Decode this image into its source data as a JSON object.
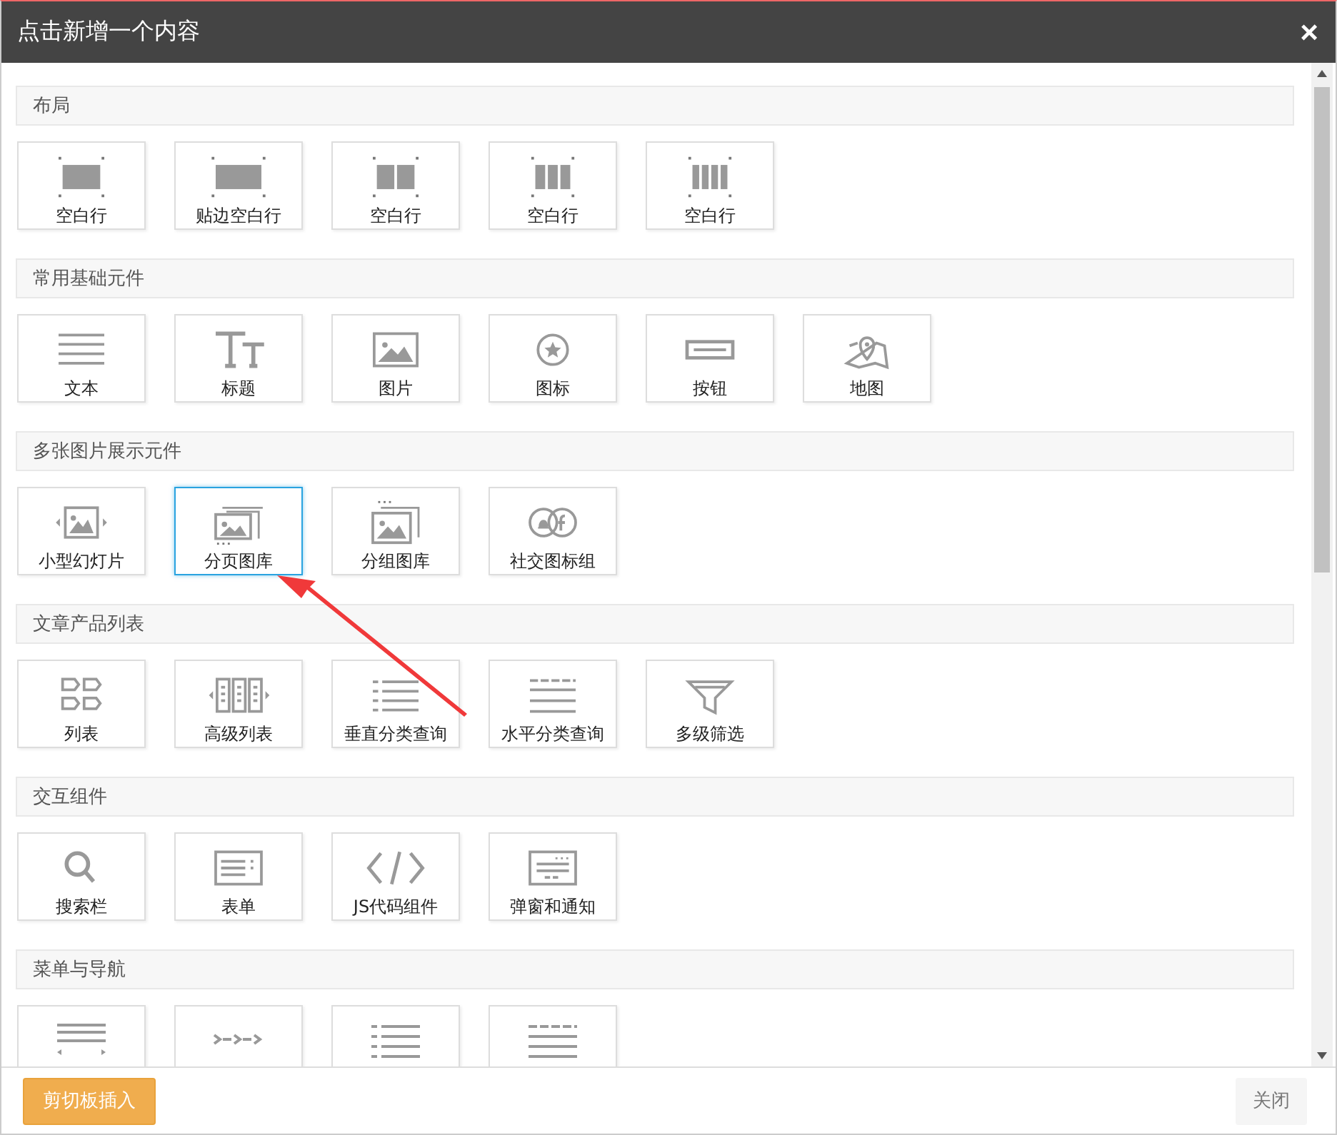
{
  "window": {
    "title": "点击新增一个内容",
    "close": "×"
  },
  "sections": [
    {
      "title": "布局",
      "items": [
        {
          "label": "空白行",
          "selected": false
        },
        {
          "label": "贴边空白行",
          "selected": false
        },
        {
          "label": "空白行",
          "selected": false
        },
        {
          "label": "空白行",
          "selected": false
        },
        {
          "label": "空白行",
          "selected": false
        }
      ]
    },
    {
      "title": "常用基础元件",
      "items": [
        {
          "label": "文本",
          "selected": false
        },
        {
          "label": "标题",
          "selected": false
        },
        {
          "label": "图片",
          "selected": false
        },
        {
          "label": "图标",
          "selected": false
        },
        {
          "label": "按钮",
          "selected": false
        },
        {
          "label": "地图",
          "selected": false
        }
      ]
    },
    {
      "title": "多张图片展示元件",
      "items": [
        {
          "label": "小型幻灯片",
          "selected": false
        },
        {
          "label": "分页图库",
          "selected": true
        },
        {
          "label": "分组图库",
          "selected": false
        },
        {
          "label": "社交图标组",
          "selected": false
        }
      ]
    },
    {
      "title": "文章产品列表",
      "items": [
        {
          "label": "列表",
          "selected": false
        },
        {
          "label": "高级列表",
          "selected": false
        },
        {
          "label": "垂直分类查询",
          "selected": false
        },
        {
          "label": "水平分类查询",
          "selected": false
        },
        {
          "label": "多级筛选",
          "selected": false
        }
      ]
    },
    {
      "title": "交互组件",
      "items": [
        {
          "label": "搜索栏",
          "selected": false
        },
        {
          "label": "表单",
          "selected": false
        },
        {
          "label": "JS代码组件",
          "selected": false
        },
        {
          "label": "弹窗和通知",
          "selected": false
        }
      ]
    },
    {
      "title": "菜单与导航",
      "items": [
        {
          "selected": false
        },
        {
          "selected": false
        },
        {
          "selected": false
        },
        {
          "selected": false
        }
      ]
    }
  ],
  "footer": {
    "paste_button": "剪切板插入",
    "close_button": "关闭"
  }
}
